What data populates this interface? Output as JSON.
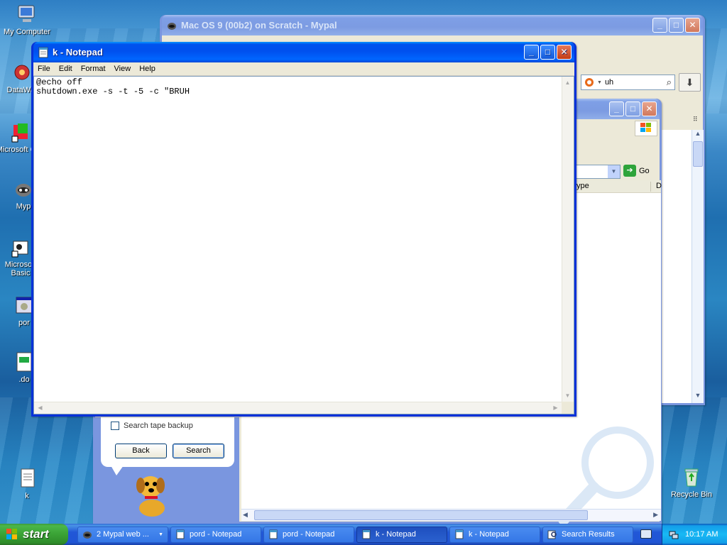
{
  "desktop": {
    "icons": [
      {
        "label": "My Computer",
        "icon": "computer-icon"
      },
      {
        "label": "DataWar",
        "icon": "application-icon"
      },
      {
        "label": "Microsoft C++",
        "icon": "shortcut-icon"
      },
      {
        "label": "Myp",
        "icon": "raccoon-icon"
      },
      {
        "label": "Microsoft Basic",
        "icon": "shortcut-icon"
      },
      {
        "label": "por",
        "icon": "executable-icon"
      },
      {
        "label": ".do",
        "icon": "batch-file-icon"
      },
      {
        "label": "k",
        "icon": "text-file-icon"
      },
      {
        "label": "Recycle Bin",
        "icon": "recycle-bin-icon"
      }
    ]
  },
  "browser": {
    "title": "Mac OS 9 (00b2) on Scratch - Mypal",
    "search_value": "uh"
  },
  "search_window": {
    "go_label": "Go",
    "column_type": "ype",
    "column_d": "D",
    "checkbox_label": "Search tape backup",
    "back_label": "Back",
    "search_label": "Search"
  },
  "notepad": {
    "title": "k - Notepad",
    "menu": [
      "File",
      "Edit",
      "Format",
      "View",
      "Help"
    ],
    "content": "@echo off\nshutdown.exe -s -t -5 -c \"BRUH"
  },
  "taskbar": {
    "start_label": "start",
    "items": [
      {
        "label": "2 Mypal web ...",
        "icon": "raccoon-icon",
        "active": false
      },
      {
        "label": "pord - Notepad",
        "icon": "notepad-icon",
        "active": false
      },
      {
        "label": "pord - Notepad",
        "icon": "notepad-icon",
        "active": false
      },
      {
        "label": "k - Notepad",
        "icon": "notepad-icon",
        "active": true
      },
      {
        "label": "k - Notepad",
        "icon": "notepad-icon",
        "active": false
      },
      {
        "label": "Search Results",
        "icon": "search-results-icon",
        "active": false
      }
    ],
    "clock": "10:17 AM"
  },
  "colors": {
    "xp_blue": "#0054e3",
    "start_green": "#3aa235",
    "desktop_sea": "#2a86c2"
  }
}
